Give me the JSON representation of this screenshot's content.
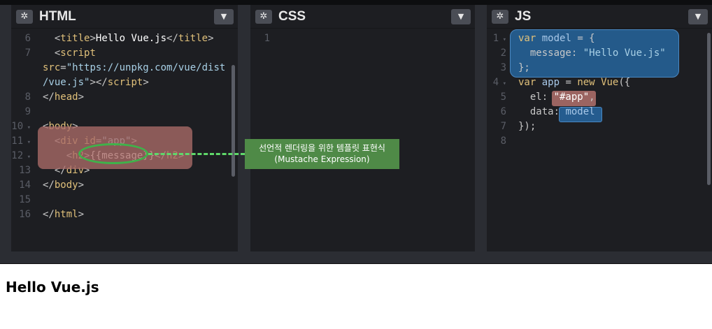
{
  "panes": {
    "html": {
      "title": "HTML",
      "settings_icon": "gear-icon",
      "collapse_icon": "chevron-down-icon",
      "lines": [
        {
          "n": "6",
          "fold": "",
          "parts": [
            [
              "c-punct",
              "  <"
            ],
            [
              "c-tag",
              "title"
            ],
            [
              "c-punct",
              ">"
            ],
            [
              "c-white",
              "Hello Vue.js"
            ],
            [
              "c-punct",
              "</"
            ],
            [
              "c-tag",
              "title"
            ],
            [
              "c-punct",
              ">"
            ]
          ]
        },
        {
          "n": "7",
          "fold": "",
          "parts": [
            [
              "c-punct",
              "  <"
            ],
            [
              "c-tag",
              "script"
            ]
          ]
        },
        {
          "n": "",
          "fold": "",
          "parts": [
            [
              "c-attr",
              "src"
            ],
            [
              "c-punct",
              "="
            ],
            [
              "c-str",
              "\"https://unpkg.com/vue/dist"
            ]
          ]
        },
        {
          "n": "",
          "fold": "",
          "parts": [
            [
              "c-str",
              "/vue.js\""
            ],
            [
              "c-punct",
              "></"
            ],
            [
              "c-tag",
              "script"
            ],
            [
              "c-punct",
              ">"
            ]
          ]
        },
        {
          "n": "8",
          "fold": "",
          "parts": [
            [
              "c-punct",
              "</"
            ],
            [
              "c-tag",
              "head"
            ],
            [
              "c-punct",
              ">"
            ]
          ]
        },
        {
          "n": "9",
          "fold": "",
          "parts": []
        },
        {
          "n": "10",
          "fold": "▾",
          "parts": [
            [
              "c-punct",
              "<"
            ],
            [
              "c-tag",
              "body"
            ],
            [
              "c-punct",
              ">"
            ]
          ]
        },
        {
          "n": "11",
          "fold": "▾",
          "parts": [
            [
              "c-punct",
              "  <"
            ],
            [
              "c-tag",
              "div"
            ],
            [
              "c-punct",
              " "
            ],
            [
              "c-attr",
              "id"
            ],
            [
              "c-punct",
              "="
            ],
            [
              "c-str",
              "\"app\""
            ],
            [
              "c-punct",
              ">"
            ]
          ]
        },
        {
          "n": "12",
          "fold": "▾",
          "parts": [
            [
              "c-punct",
              "    <"
            ],
            [
              "c-tag",
              "h2"
            ],
            [
              "c-punct",
              ">"
            ],
            [
              "c-white",
              "{{message}}"
            ],
            [
              "c-punct",
              "</"
            ],
            [
              "c-tag",
              "h2"
            ],
            [
              "c-punct",
              ">"
            ]
          ]
        },
        {
          "n": "13",
          "fold": "",
          "parts": [
            [
              "c-punct",
              "  </"
            ],
            [
              "c-tag",
              "div"
            ],
            [
              "c-punct",
              ">"
            ]
          ]
        },
        {
          "n": "14",
          "fold": "",
          "parts": [
            [
              "c-punct",
              "</"
            ],
            [
              "c-tag",
              "body"
            ],
            [
              "c-punct",
              ">"
            ]
          ]
        },
        {
          "n": "15",
          "fold": "",
          "parts": []
        },
        {
          "n": "16",
          "fold": "",
          "parts": [
            [
              "c-punct",
              "</"
            ],
            [
              "c-tag",
              "html"
            ],
            [
              "c-punct",
              ">"
            ]
          ]
        }
      ]
    },
    "css": {
      "title": "CSS",
      "settings_icon": "gear-icon",
      "collapse_icon": "chevron-down-icon",
      "lines": [
        {
          "n": "1",
          "fold": "",
          "parts": []
        }
      ]
    },
    "js": {
      "title": "JS",
      "settings_icon": "gear-icon",
      "collapse_icon": "chevron-down-icon",
      "lines": [
        {
          "n": "1",
          "fold": "▾",
          "parts": [
            [
              "c-kw",
              "var"
            ],
            [
              "c-punct",
              " "
            ],
            [
              "c-var",
              "model"
            ],
            [
              "c-punct",
              " = {"
            ]
          ]
        },
        {
          "n": "2",
          "fold": "",
          "parts": [
            [
              "c-punct",
              "  message: "
            ],
            [
              "c-str",
              "\"Hello Vue.js\""
            ]
          ]
        },
        {
          "n": "3",
          "fold": "",
          "parts": [
            [
              "c-punct",
              "};"
            ]
          ]
        },
        {
          "n": "4",
          "fold": "▾",
          "parts": [
            [
              "c-kw",
              "var"
            ],
            [
              "c-punct",
              " "
            ],
            [
              "c-var",
              "app"
            ],
            [
              "c-punct",
              " = "
            ],
            [
              "c-kw",
              "new"
            ],
            [
              "c-punct",
              " "
            ],
            [
              "c-tag",
              "Vue"
            ],
            [
              "c-punct",
              "({"
            ]
          ]
        },
        {
          "n": "5",
          "fold": "",
          "parts": [
            [
              "c-punct",
              "  el: "
            ],
            [
              "c-white",
              "\"#app\""
            ],
            [
              "c-punct",
              ","
            ]
          ]
        },
        {
          "n": "6",
          "fold": "",
          "parts": [
            [
              "c-punct",
              "  data: "
            ],
            [
              "c-var",
              "model"
            ]
          ]
        },
        {
          "n": "7",
          "fold": "",
          "parts": [
            [
              "c-punct",
              "});"
            ]
          ]
        },
        {
          "n": "8",
          "fold": "",
          "parts": []
        }
      ]
    }
  },
  "annotation": {
    "line1": "선언적 렌더링을 위한 템플릿 표현식",
    "line2": "(Mustache Expression)"
  },
  "result": {
    "heading": "Hello Vue.js"
  },
  "colors": {
    "editor_bg": "#1d1e22",
    "highlight_red": "#aa6c68",
    "highlight_blue": "#266096",
    "annotation_green": "#4f8a47",
    "ellipse_green": "#3fb24a"
  }
}
